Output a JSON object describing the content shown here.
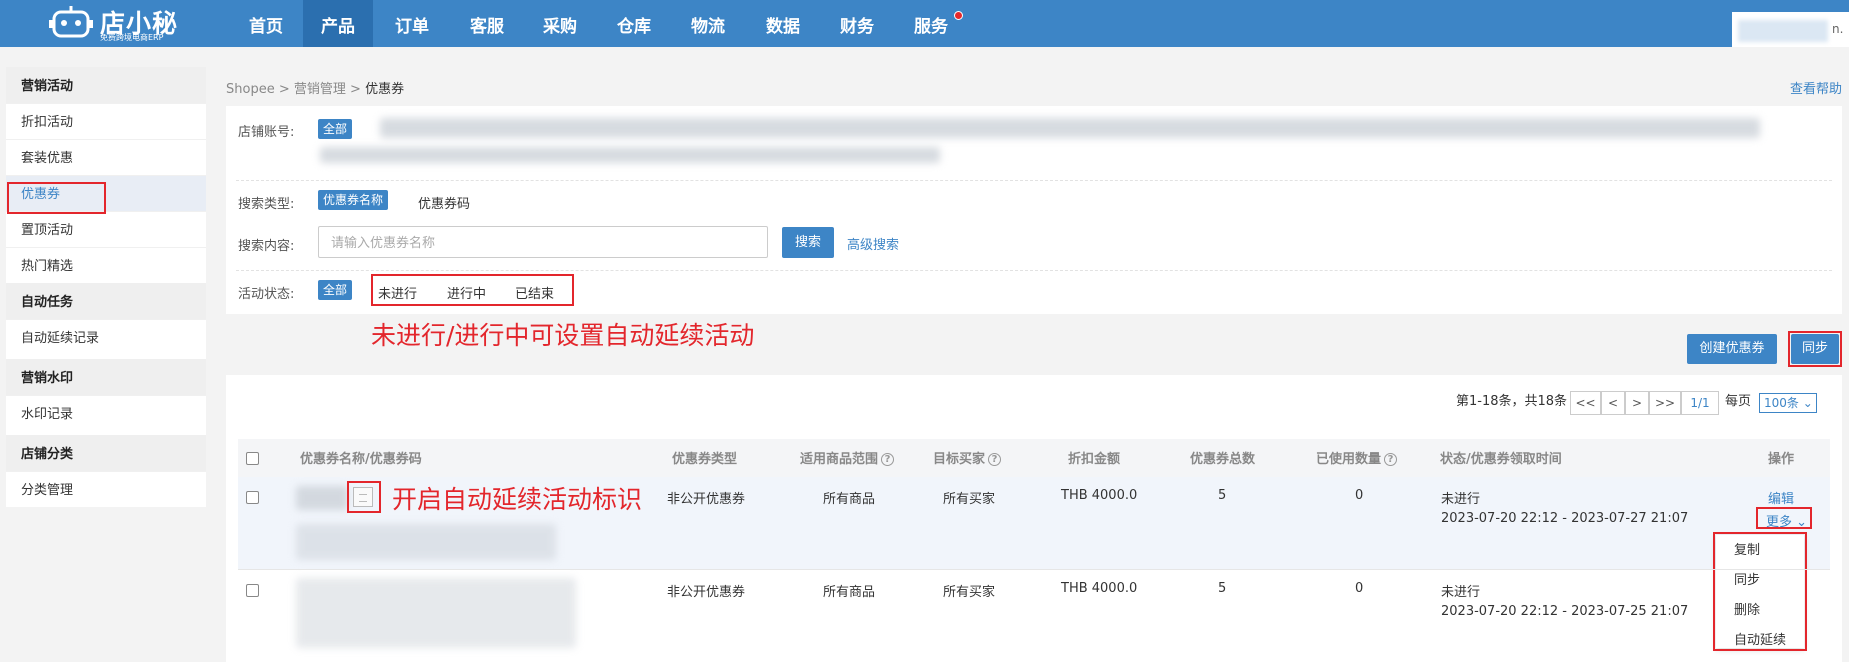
{
  "logo": {
    "name": "店小秘",
    "subtitle": "免费跨境电商ERP"
  },
  "nav": {
    "items": [
      "首页",
      "产品",
      "订单",
      "客服",
      "采购",
      "仓库",
      "物流",
      "数据",
      "财务",
      "服务"
    ]
  },
  "user": {
    "suffix": "n."
  },
  "sidebar": {
    "groups": [
      "营销活动",
      "自动任务",
      "营销水印",
      "店铺分类"
    ],
    "items": [
      "折扣活动",
      "套装优惠",
      "优惠券",
      "置顶活动",
      "热门精选",
      "自动延续记录",
      "水印记录",
      "分类管理"
    ]
  },
  "breadcrumb": {
    "a": "Shopee",
    "sep": ">",
    "b": "营销管理",
    "c": "优惠券"
  },
  "help": "查看帮助",
  "filter": {
    "shop_label": "店铺账号:",
    "all": "全部",
    "type_label": "搜索类型:",
    "type_active": "优惠券名称",
    "type_other": "优惠券码",
    "content_label": "搜索内容:",
    "placeholder": "请输入优惠券名称",
    "search_btn": "搜索",
    "adv_search": "高级搜索",
    "status_label": "活动状态:",
    "status_all": "全部",
    "status_options": [
      "未进行",
      "进行中",
      "已结束"
    ]
  },
  "annotations": {
    "status_note": "未进行/进行中可设置自动延续活动",
    "icon_note": "开启自动延续活动标识"
  },
  "actions": {
    "create": "创建优惠券",
    "sync": "同步"
  },
  "pager": {
    "summary": "第1-18条，共18条",
    "first": "<<",
    "prev": "<",
    "next": ">",
    "last": ">>",
    "page": "1/1",
    "per_page_label": "每页",
    "per_page": "100条"
  },
  "table": {
    "headers": [
      "优惠券名称/优惠券码",
      "优惠券类型",
      "适用商品范围",
      "目标买家",
      "折扣金额",
      "优惠券总数",
      "已使用数量",
      "状态/优惠券领取时间",
      "操作"
    ],
    "rows": [
      {
        "type": "非公开优惠券",
        "scope": "所有商品",
        "buyer": "所有买家",
        "amount": "THB 4000.0",
        "total": "5",
        "used": "0",
        "status": "未进行",
        "time": "2023-07-20 22:12 - 2023-07-27 21:07"
      },
      {
        "type": "非公开优惠券",
        "scope": "所有商品",
        "buyer": "所有买家",
        "amount": "THB 4000.0",
        "total": "5",
        "used": "0",
        "status": "未进行",
        "time": "2023-07-20 22:12 - 2023-07-25 21:07"
      }
    ],
    "edit": "编辑",
    "more": "更多",
    "more_menu": [
      "复制",
      "同步",
      "删除",
      "自动延续"
    ]
  },
  "colors": {
    "primary": "#3d85c6",
    "annotation": "#e3262c"
  }
}
